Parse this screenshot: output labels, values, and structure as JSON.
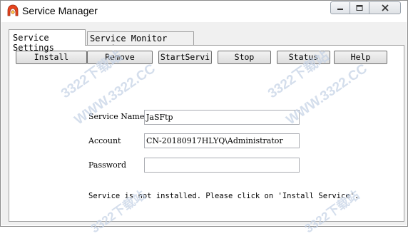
{
  "window": {
    "title": "Service Manager",
    "icon": "app-icon",
    "controls": [
      "minimize-icon",
      "maximize-icon",
      "close-icon"
    ]
  },
  "tabs": [
    {
      "label": "Service Settings",
      "active": true
    },
    {
      "label": "Service Monitor Settings",
      "active": false
    }
  ],
  "toolbar": {
    "install": "Install",
    "remove": "Remove",
    "start": "StartServi",
    "stop": "Stop",
    "status": "Status",
    "help": "Help"
  },
  "form": {
    "service_name_label": "Service Name",
    "service_name_value": "JaSFtp",
    "account_label": "Account",
    "account_value": "CN-20180917HLYQ\\Administrator",
    "password_label": "Password",
    "password_value": ""
  },
  "status_message": "Service is not installed.  Please click on 'Install Service'.",
  "watermarks": {
    "site_a": "3322下载站",
    "site_b": "WWW.3322.CC"
  },
  "colors": {
    "window_bg": "#f0f0f0",
    "panel_bg": "#ffffff",
    "border": "#a0a0a0",
    "watermark": "#c6d3e6"
  }
}
